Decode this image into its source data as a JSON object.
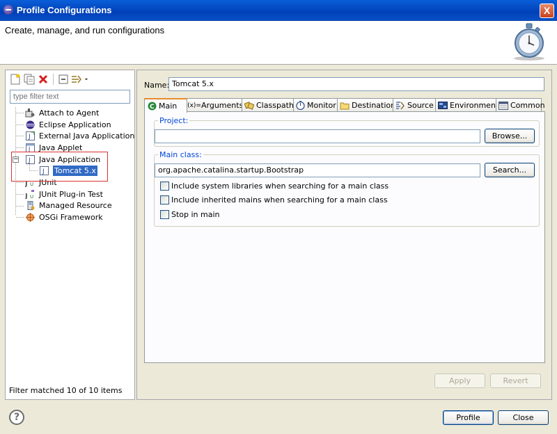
{
  "window": {
    "title": "Profile Configurations",
    "close_glyph": "X"
  },
  "banner": {
    "heading": "Create, manage, and run configurations",
    "icon": "stopwatch-icon"
  },
  "left": {
    "toolbar": [
      "new-config-icon",
      "duplicate-icon",
      "delete-icon",
      "collapse-all-icon",
      "filter-icon"
    ],
    "filter_placeholder": "type filter text",
    "tree": [
      {
        "label": "Attach to Agent",
        "icon": "agent-icon",
        "level": 1
      },
      {
        "label": "Eclipse Application",
        "icon": "eclipse-icon",
        "level": 1
      },
      {
        "label": "External Java Application",
        "icon": "external-java-icon",
        "level": 1
      },
      {
        "label": "Java Applet",
        "icon": "applet-icon",
        "level": 1
      },
      {
        "label": "Java Application",
        "icon": "java-app-icon",
        "level": 1,
        "expanded": true
      },
      {
        "label": "Tomcat 5.x",
        "icon": "java-config-icon",
        "level": 2,
        "selected": true
      },
      {
        "label": "JUnit",
        "icon": "junit-icon",
        "level": 1
      },
      {
        "label": "JUnit Plug-in Test",
        "icon": "junit-plugin-icon",
        "level": 1
      },
      {
        "label": "Managed Resource",
        "icon": "managed-resource-icon",
        "level": 1
      },
      {
        "label": "OSGi Framework",
        "icon": "osgi-icon",
        "level": 1
      }
    ],
    "status": "Filter matched 10 of 10 items"
  },
  "right": {
    "name_label": "Name:",
    "name_value": "Tomcat 5.x",
    "tabs": [
      {
        "label": "Main",
        "icon": "main-tab-icon",
        "active": true
      },
      {
        "label": "Arguments",
        "icon": "arguments-icon"
      },
      {
        "label": "Classpath",
        "icon": "classpath-icon"
      },
      {
        "label": "Monitor",
        "icon": "monitor-icon"
      },
      {
        "label": "Destination",
        "icon": "folder-icon"
      },
      {
        "label": "Source",
        "icon": "source-icon"
      },
      {
        "label": "Environment",
        "icon": "environment-icon"
      },
      {
        "label": "Common",
        "icon": "common-icon"
      }
    ],
    "project": {
      "label": "Project:",
      "value": "",
      "browse": "Browse..."
    },
    "main_class": {
      "label": "Main class:",
      "value": "org.apache.catalina.startup.Bootstrap",
      "search": "Search...",
      "options": [
        {
          "label": "Include system libraries when searching for a main class",
          "checked": false
        },
        {
          "label": "Include inherited mains when searching for a main class",
          "checked": false
        },
        {
          "label": "Stop in main",
          "checked": false
        }
      ]
    },
    "apply": "Apply",
    "revert": "Revert"
  },
  "footer": {
    "help_glyph": "?",
    "profile": "Profile",
    "close": "Close"
  }
}
